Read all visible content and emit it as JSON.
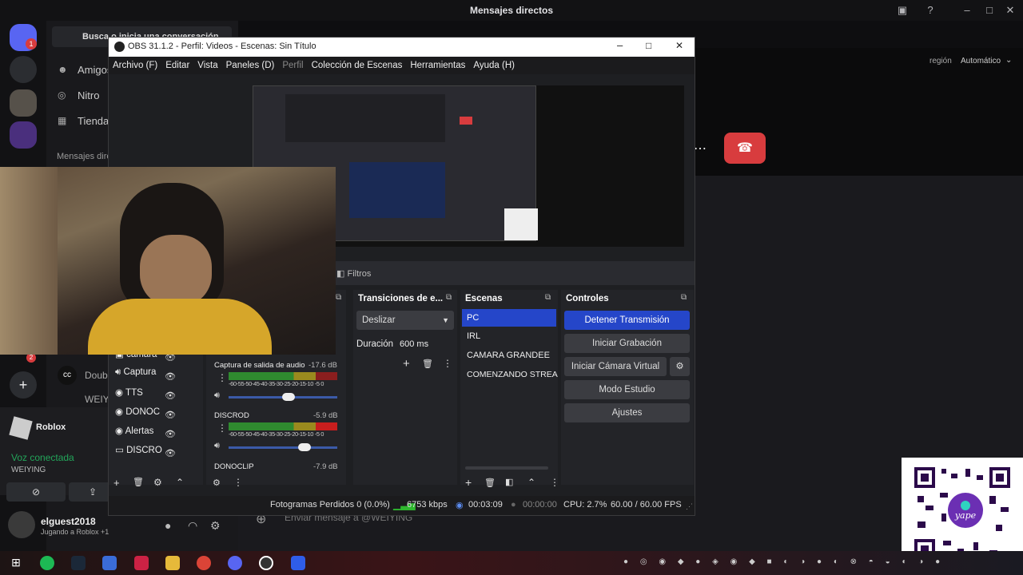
{
  "discord": {
    "title": "Mensajes directos",
    "search_placeholder": "Busca o inicia una conversación",
    "nav": [
      "Amigos",
      "Nitro",
      "Tienda"
    ],
    "section": "Mensajes dire",
    "dm_partial": [
      "Doub",
      "WEIY"
    ],
    "region_label": "región",
    "region_value": "Automático",
    "voice_status": "Voz conectada",
    "voice_user": "WEIYING",
    "activity_app": "Roblox",
    "username": "elguest2018",
    "user_status": "Jugando a Roblox +1",
    "chat_placeholder": "Enviar mensaje a @WEIYING",
    "server_badge": "1",
    "badge2": "2",
    "colors": {
      "hangup": "#d83c3e",
      "connected": "#23a55a",
      "accent": "#5865f2"
    }
  },
  "obs": {
    "title": "OBS 31.1.2 - Perfil: Videos - Escenas: Sin Título",
    "menu": [
      "Archivo (F)",
      "Editar",
      "Vista",
      "Paneles (D)",
      "Perfil",
      "Colección de Escenas",
      "Herramientas",
      "Ayuda (H)"
    ],
    "filters_label": "Filtros",
    "sources": [
      "camara",
      "Captura",
      "TTS",
      "DONOC",
      "Alertas",
      "DISCRO"
    ],
    "mixer": [
      {
        "name": "Captura de salida de audio",
        "db": "-17.6 dB",
        "level": 0.55
      },
      {
        "name": "DISCROD",
        "db": "-5.9 dB",
        "level": 0.7
      },
      {
        "name": "DONOCLIP",
        "db": "-7.9 dB"
      }
    ],
    "meter_scale": "-60-55-50-45-40-35-30-25-20-15-10 -5 0",
    "transitions": {
      "header": "Transiciones de e...",
      "type": "Deslizar",
      "duration_label": "Duración",
      "duration_value": "600 ms"
    },
    "scenes": {
      "header": "Escenas",
      "items": [
        "PC",
        "IRL",
        "CAMARA GRANDEE",
        "COMENZANDO STREAM"
      ]
    },
    "controls": {
      "header": "Controles",
      "stop": "Detener Transmisión",
      "record": "Iniciar Grabación",
      "virtual": "Iniciar Cámara Virtual",
      "studio": "Modo Estudio",
      "settings": "Ajustes"
    },
    "status": {
      "dropped": "Fotogramas Perdidos 0 (0.0%)",
      "kbps": "6753 kbps",
      "stream_time": "00:03:09",
      "rec_time": "00:00:00",
      "cpu": "CPU: 2.7%",
      "fps": "60.00 / 60.00 FPS"
    },
    "colors": {
      "active": "#2546c9",
      "bitrate": "#2eb82e"
    }
  },
  "qr_brand": "yape"
}
